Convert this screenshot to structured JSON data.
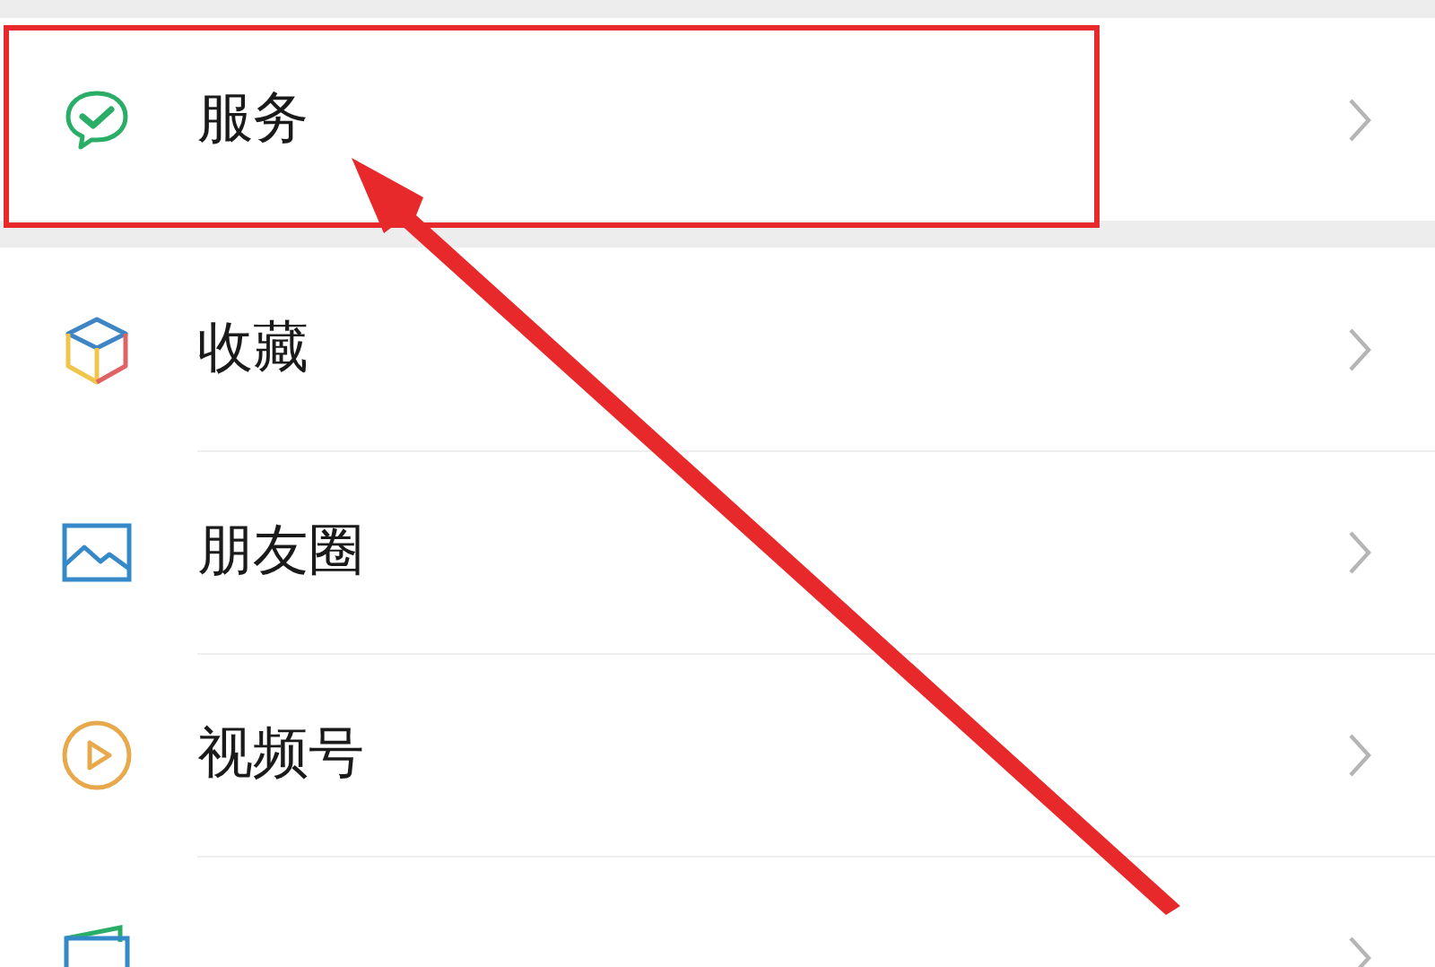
{
  "groups": [
    {
      "items": [
        {
          "label": "服务",
          "highlighted": true
        }
      ]
    },
    {
      "items": [
        {
          "label": "收藏",
          "highlighted": false
        },
        {
          "label": "朋友圈",
          "highlighted": false
        },
        {
          "label": "视频号",
          "highlighted": false
        },
        {
          "highlighted": false
        }
      ]
    }
  ]
}
